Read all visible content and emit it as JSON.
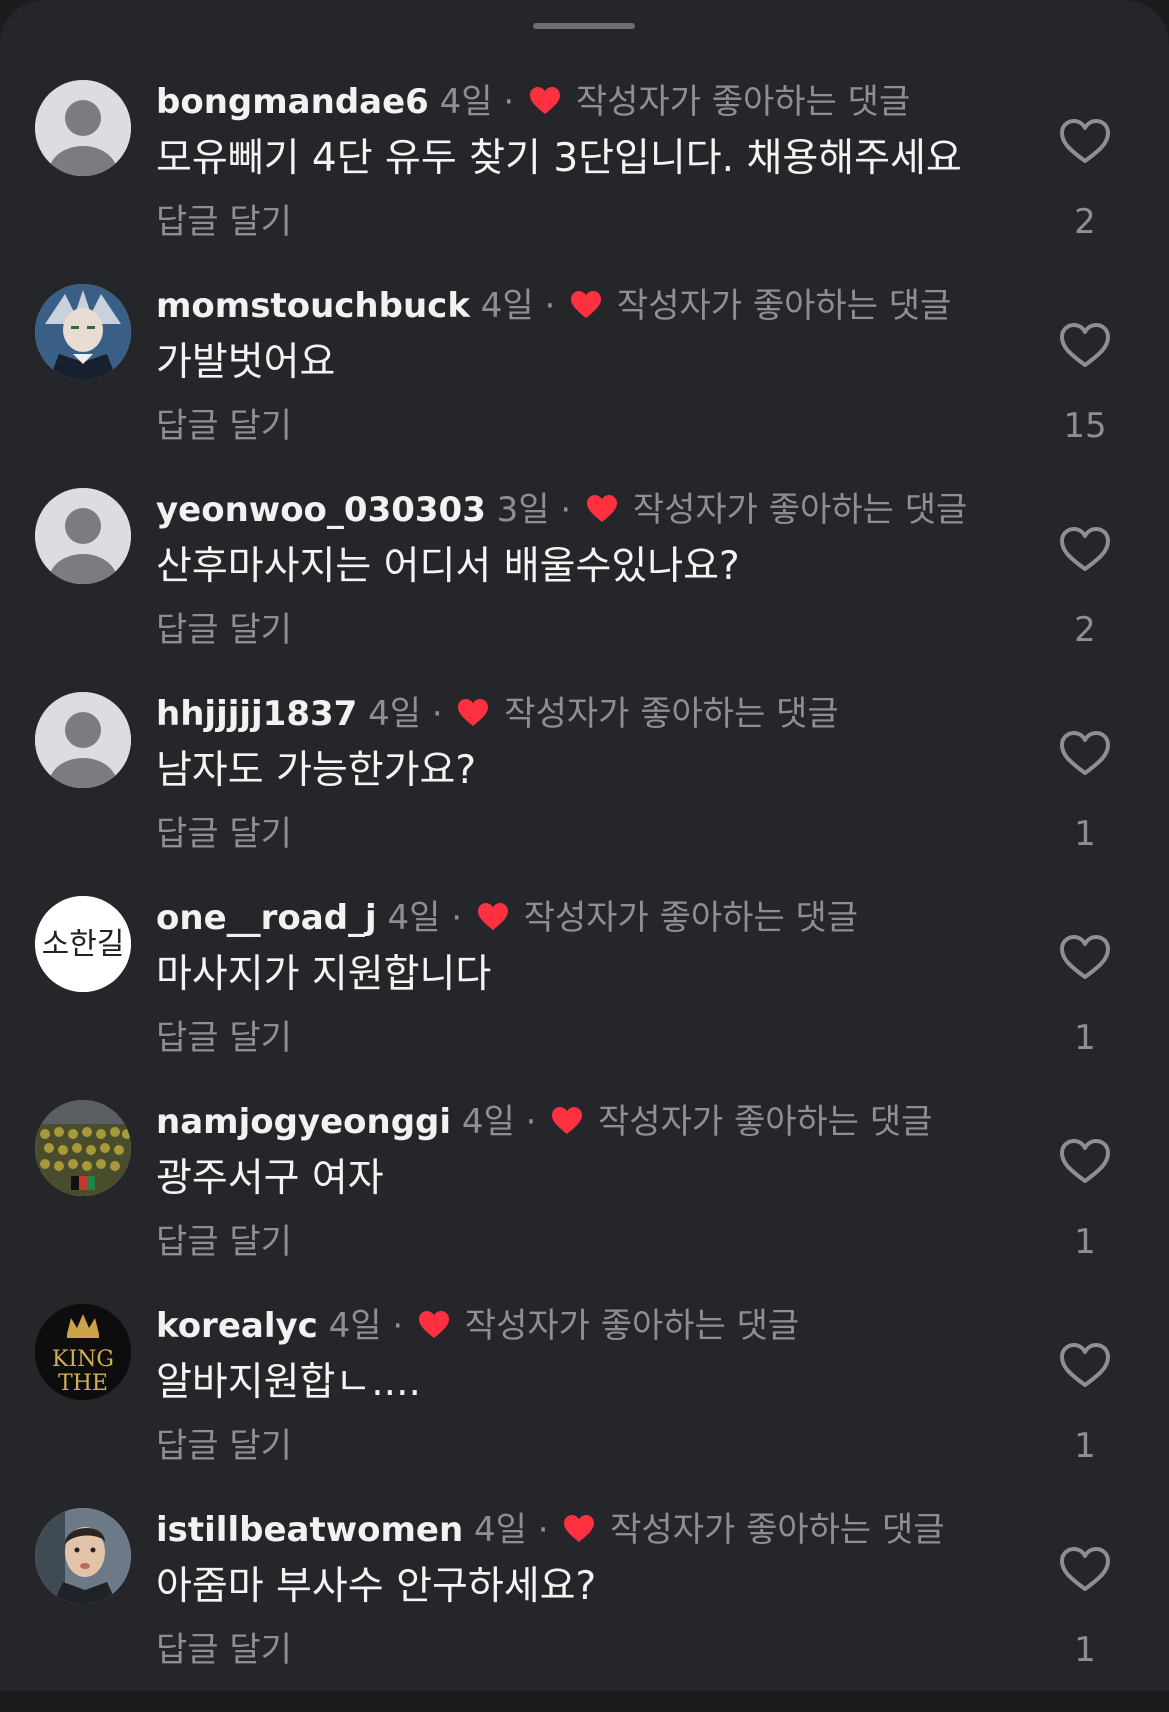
{
  "sheet": {
    "liked_by_author_label": "작성자가 좋아하는 댓글",
    "reply_label": "답글 달기",
    "separator": "·"
  },
  "comments": [
    {
      "username": "bongmandae6",
      "age": "4일",
      "text": "모유빼기 4단 유두 찾기 3단입니다. 채용해주세요",
      "likes": "2",
      "avatar": "default-avatar"
    },
    {
      "username": "momstouchbuck",
      "age": "4일",
      "text": "가발벗어요",
      "likes": "15",
      "avatar": "anime-character-avatar"
    },
    {
      "username": "yeonwoo_030303",
      "age": "3일",
      "text": "산후마사지는 어디서 배울수있나요?",
      "likes": "2",
      "avatar": "default-avatar"
    },
    {
      "username": "hhjjjjj1837",
      "age": "4일",
      "text": "남자도 가능한가요?",
      "likes": "1",
      "avatar": "default-avatar"
    },
    {
      "username": "one__road_j",
      "age": "4일",
      "text": "마사지가 지원합니다",
      "likes": "1",
      "avatar": "handwriting-avatar",
      "avatar_text": "소한길"
    },
    {
      "username": "namjogyeonggi",
      "age": "4일",
      "text": "광주서구 여자",
      "likes": "1",
      "avatar": "crowd-photo-avatar"
    },
    {
      "username": "korealyc",
      "age": "4일",
      "text": "알바지원합ㄴ....",
      "likes": "1",
      "avatar": "king-logo-avatar",
      "avatar_text_line1": "KING",
      "avatar_text_line2": "THE"
    },
    {
      "username": "istillbeatwomen",
      "age": "4일",
      "text": "아줌마 부사수 안구하세요?",
      "likes": "1",
      "avatar": "person-photo-avatar"
    }
  ],
  "colors": {
    "background": "#252629",
    "heart_red": "#ff3040",
    "secondary_text": "#8e8f94",
    "primary_text": "#f4f4f4"
  }
}
